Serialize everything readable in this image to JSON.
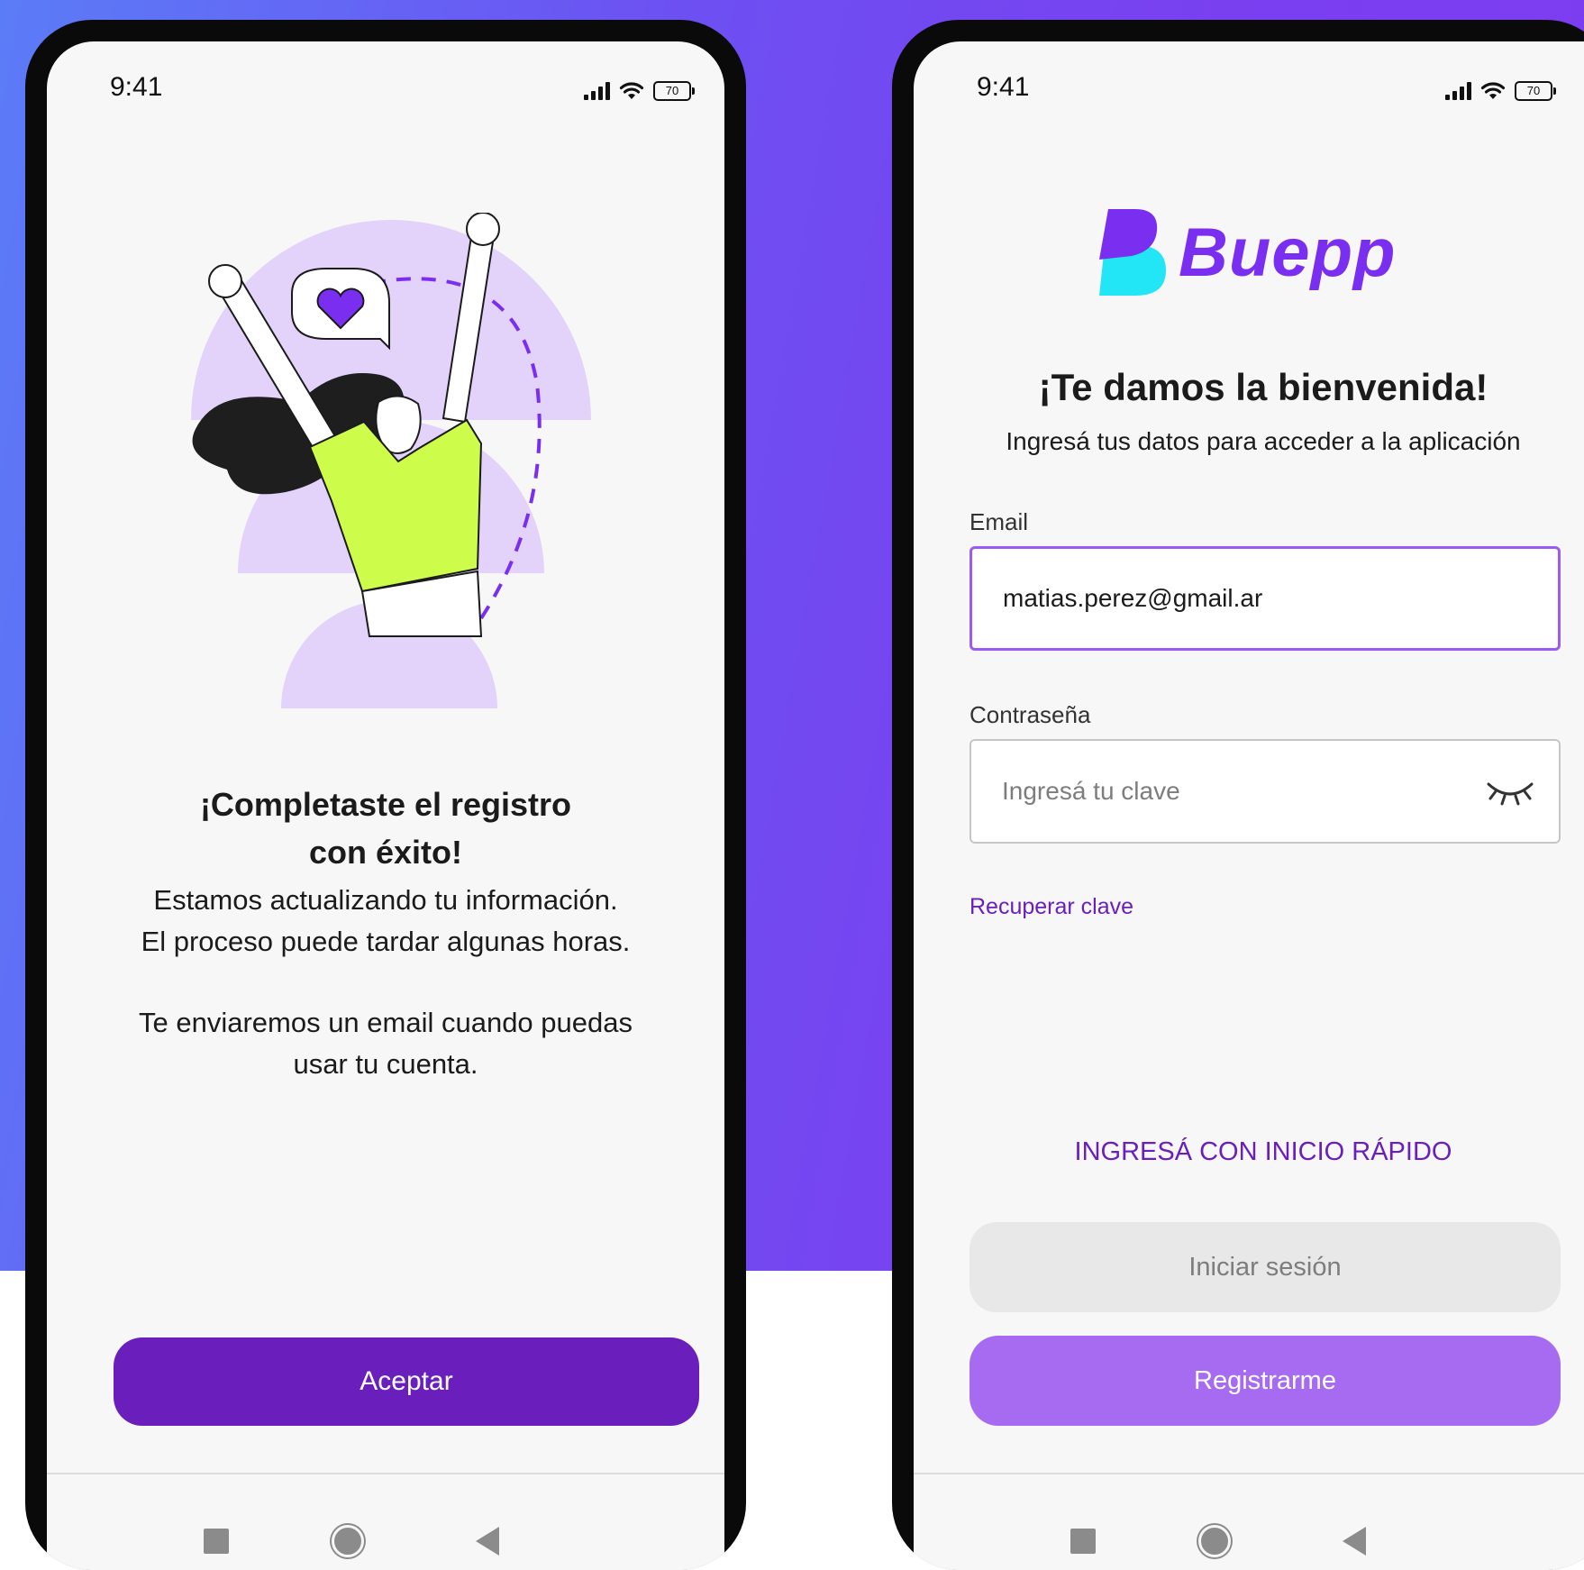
{
  "colors": {
    "accent": "#6a1fbd",
    "accent_light": "#a66bf0",
    "email_border": "#9b59f5",
    "illustration_shirt": "#cdfc4a",
    "logo_purple": "#7a2ff0",
    "logo_cyan": "#22e6f5"
  },
  "left_screen": {
    "status": {
      "time": "9:41",
      "battery": "70"
    },
    "title_line1": "¡Completaste el registro",
    "title_line2": "con éxito!",
    "body_1": "Estamos actualizando tu información.\nEl proceso puede tardar algunas horas.",
    "body_2": "Te enviaremos un email cuando puedas\nusar tu cuenta.",
    "accept_button": "Aceptar",
    "nav_icons": [
      "square-icon",
      "circle-icon",
      "back-triangle-icon"
    ]
  },
  "right_screen": {
    "status": {
      "time": "9:41",
      "battery": "70"
    },
    "logo_text": "Buepp",
    "welcome_title": "¡Te damos la bienvenida!",
    "welcome_subtitle": "Ingresá tus datos para acceder a la aplicación",
    "email": {
      "label": "Email",
      "value": "matias.perez@gmail.ar"
    },
    "password": {
      "label": "Contraseña",
      "placeholder": "Ingresá tu clave"
    },
    "recover_link": "Recuperar clave",
    "quick_login_link": "INGRESÁ CON INICIO RÁPIDO",
    "login_button": "Iniciar sesión",
    "register_button": "Registrarme",
    "nav_icons": [
      "square-icon",
      "circle-icon",
      "back-triangle-icon"
    ]
  }
}
